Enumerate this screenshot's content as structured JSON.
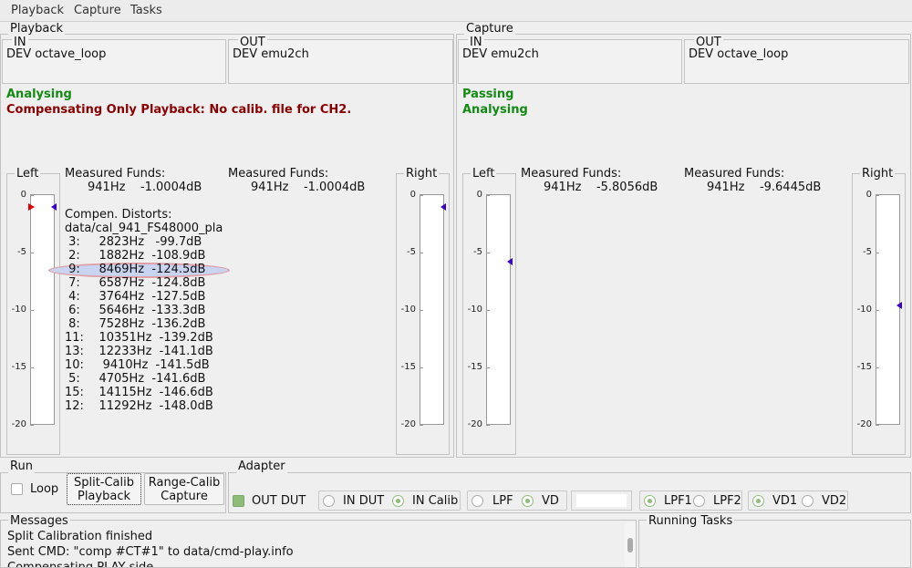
{
  "menu": [
    "Playback",
    "Capture",
    "Tasks"
  ],
  "playback": {
    "title": "Playback",
    "in_label": "IN",
    "in_dev": "DEV octave_loop",
    "out_label": "OUT",
    "out_dev": "DEV emu2ch",
    "status1": "Analysing",
    "status2": "Compensating Only Playback:  No calib. file for CH2.",
    "left_label": "Left",
    "right_label": "Right",
    "funds_left_title": "Measured Funds:",
    "funds_left_val": "941Hz    -1.0004dB",
    "funds_right_title": "Measured Funds:",
    "funds_right_val": "941Hz    -1.0004dB",
    "distorts_title": "Compen. Distorts:",
    "distorts_file": "data/cal_941_FS48000_pla",
    "distorts": [
      " 3:     2823Hz   -99.7dB",
      " 2:     1882Hz  -108.9dB",
      " 9:     8469Hz  -124.5dB",
      " 7:     6587Hz  -124.8dB",
      " 4:     3764Hz  -127.5dB",
      " 6:     5646Hz  -133.3dB",
      " 8:     7528Hz  -136.2dB",
      "11:    10351Hz  -139.2dB",
      "13:    12233Hz  -141.1dB",
      "10:     9410Hz  -141.5dB",
      " 5:     4705Hz  -141.6dB",
      "15:    14115Hz  -146.6dB",
      "12:    11292Hz  -148.0dB"
    ],
    "meter_left_level_db": -1.0,
    "meter_right_level_db": -1.0
  },
  "capture": {
    "title": "Capture",
    "in_label": "IN",
    "in_dev": "DEV emu2ch",
    "out_label": "OUT",
    "out_dev": "DEV octave_loop",
    "status1": "Passing",
    "status2": "Analysing",
    "left_label": "Left",
    "right_label": "Right",
    "funds_left_title": "Measured Funds:",
    "funds_left_val": "941Hz    -5.8056dB",
    "funds_right_title": "Measured Funds:",
    "funds_right_val": "941Hz    -9.6445dB",
    "meter_left_level_db": -5.8,
    "meter_right_level_db": -9.6
  },
  "ticks": [
    "0",
    "-5",
    "-10",
    "-15",
    "-20"
  ],
  "run": {
    "title": "Run",
    "loop": "Loop",
    "split": "Split-Calib\nPlayback",
    "range": "Range-Calib\nCapture"
  },
  "adapter": {
    "title": "Adapter",
    "out_dut": "OUT DUT",
    "in_dut": "IN DUT",
    "in_calib": "IN Calib",
    "lpf": "LPF",
    "vd": "VD",
    "lpf1": "LPF1",
    "lpf2": "LPF2",
    "vd1": "VD1",
    "vd2": "VD2"
  },
  "messages": {
    "title": "Messages",
    "lines": [
      "Split Calibration finished",
      "Sent CMD: \"comp #CT#1\" to data/cmd-play.info",
      "Compensating PLAY side"
    ]
  },
  "tasks": {
    "title": "Running Tasks"
  }
}
